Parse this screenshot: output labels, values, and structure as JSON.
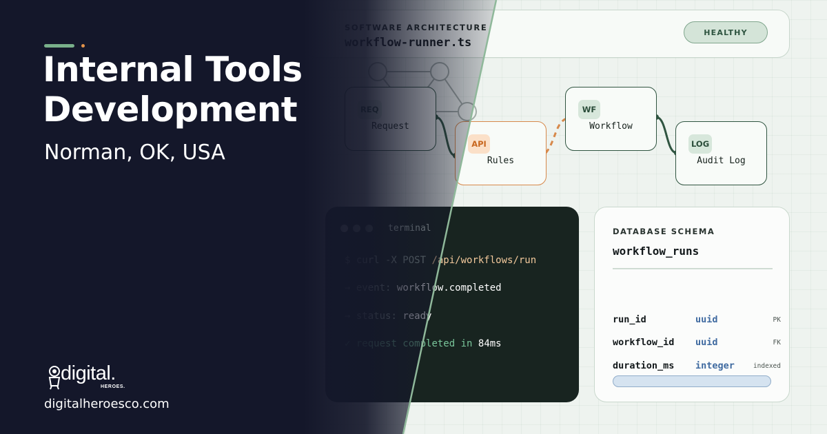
{
  "header": {
    "eyebrow": "SOFTWARE ARCHITECTURE",
    "filename": "workflow-runner.ts",
    "status": "HEALTHY"
  },
  "nodes": [
    {
      "tag": "REQ",
      "label": "Request"
    },
    {
      "tag": "API",
      "label": "Rules"
    },
    {
      "tag": "WF",
      "label": "Workflow"
    },
    {
      "tag": "LOG",
      "label": "Audit Log"
    }
  ],
  "terminal": {
    "title": "terminal",
    "command_prefix": "$ curl -X POST ",
    "command_path": "/api/workflows/run",
    "event_arrow": "→",
    "event_key": "event: ",
    "event_value": "workflow.completed",
    "status_arrow": "→",
    "status_key": "status: ",
    "status_value": "ready",
    "done_mark": "✓",
    "done_text": "request completed in ",
    "done_value": "84ms"
  },
  "schema": {
    "eyebrow": "DATABASE SCHEMA",
    "table": "workflow_runs",
    "rows": [
      {
        "name": "run_id",
        "type": "uuid",
        "note": "PK"
      },
      {
        "name": "workflow_id",
        "type": "uuid",
        "note": "FK"
      },
      {
        "name": "duration_ms",
        "type": "integer",
        "note": "indexed"
      }
    ]
  },
  "hero": {
    "title": "Internal Tools Development",
    "location": "Norman, OK, USA"
  },
  "brand": {
    "wordmark": "digital.",
    "sub": "HEROES.",
    "website": "digitalheroesco.com"
  },
  "colors": {
    "dark_bg": "#14172a",
    "accent_green": "#79b08a",
    "accent_orange": "#e3934a",
    "node_border": "#2f5440",
    "api_border": "#d7884a",
    "terminal_bg": "#182420"
  }
}
